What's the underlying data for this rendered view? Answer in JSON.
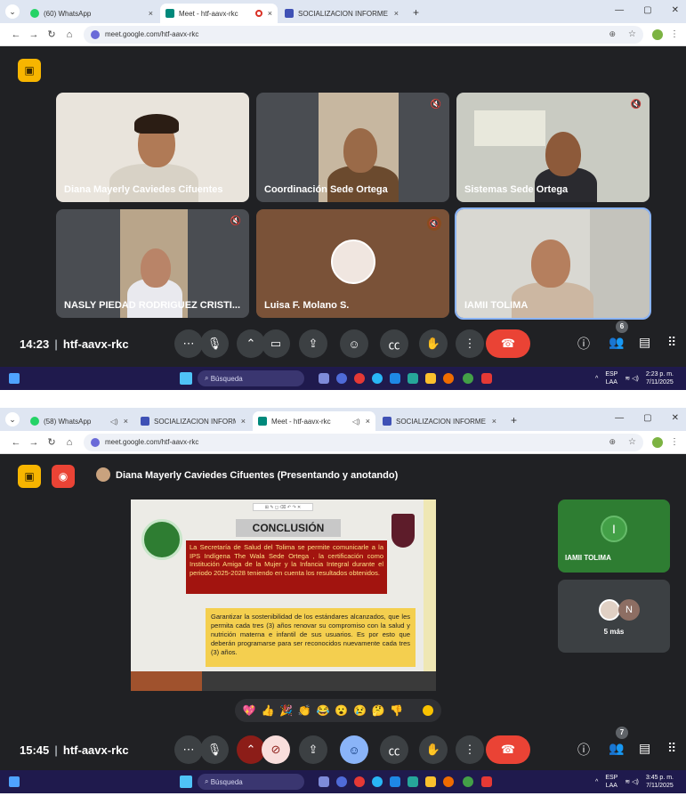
{
  "screen1": {
    "tabs": [
      {
        "title": "(60) WhatsApp",
        "close": "×",
        "icon": "whatsapp-icon",
        "color": "#25d366"
      },
      {
        "title": "Meet - htf-aavx-rkc",
        "close": "×",
        "icon": "meet-icon",
        "color": "#00897b"
      },
      {
        "title": "SOCIALIZACION INFORME EVA",
        "close": "×",
        "icon": "slides-icon",
        "color": "#3f51b5"
      }
    ],
    "new_tab": "+",
    "url": "meet.google.com/htf-aavx-rkc",
    "participants": [
      {
        "name": "Diana Mayerly Caviedes Cifuentes",
        "muted": false
      },
      {
        "name": "Coordinación Sede Ortega",
        "muted": true
      },
      {
        "name": "Sistemas Sede Ortega",
        "muted": true
      },
      {
        "name": "NASLY PIEDAD RODRIGUEZ CRISTI...",
        "muted": true
      },
      {
        "name": "Luisa F. Molano S.",
        "muted": true
      },
      {
        "name": "IAMII TOLIMA",
        "muted": false
      }
    ],
    "time": "14:23",
    "meeting_code": "htf-aavx-rkc",
    "people_count": "6",
    "taskbar": {
      "search": "Búsqueda",
      "lang": "ESP",
      "region": "LAA",
      "clock_time": "2:23 p. m.",
      "clock_date": "7/11/2025"
    }
  },
  "screen2": {
    "tabs": [
      {
        "title": "(58) WhatsApp",
        "close": "×",
        "icon": "whatsapp-icon",
        "color": "#25d366"
      },
      {
        "title": "SOCIALIZACION INFORME EVA",
        "close": "×",
        "icon": "slides-icon",
        "color": "#3f51b5"
      },
      {
        "title": "Meet - htf-aavx-rkc",
        "close": "×",
        "icon": "meet-icon",
        "color": "#00897b"
      },
      {
        "title": "SOCIALIZACION INFORME EVA",
        "close": "×",
        "icon": "slides-icon",
        "color": "#3f51b5"
      }
    ],
    "new_tab": "+",
    "url": "meet.google.com/htf-aavx-rkc",
    "presenter": "Diana Mayerly Caviedes Cifuentes (Presentando y anotando)",
    "slide": {
      "title": "CONCLUSIÓN",
      "red_text": "La Secretaría de Salud del Tolima se permite comunicarle a la IPS Indígena The Wala Sede Ortega , la certificación como Institución Amiga de la Mujer y la Infancia Integral durante el periodo 2025-2028 teniendo en cuenta los resultados obtenidos.",
      "yellow_text": "Garantizar la sostenibilidad de los estándares alcanzados, que les permita cada tres (3) años renovar su compromiso con la salud y nutrición materna e infantil de sus usuarios. Es por esto que deberán programarse para ser reconocidos nuevamente cada tres (3) años."
    },
    "side_tiles": {
      "tile1_initial": "I",
      "tile1_name": "IAMII TOLIMA",
      "tile2_initial": "N",
      "tile2_label": "5 más"
    },
    "reactions": [
      "💖",
      "👍",
      "🎉",
      "👏",
      "😂",
      "😮",
      "😢",
      "🤔",
      "👎"
    ],
    "time": "15:45",
    "meeting_code": "htf-aavx-rkc",
    "people_count": "7",
    "taskbar": {
      "search": "Búsqueda",
      "lang": "ESP",
      "region": "LAA",
      "clock_time": "3:45 p. m.",
      "clock_date": "7/11/2025"
    }
  },
  "colors": {
    "meet_bg": "#202124",
    "hangup": "#ea4335",
    "tabbar": "#dfe6f2",
    "taskbar": "#1f1a4d"
  }
}
